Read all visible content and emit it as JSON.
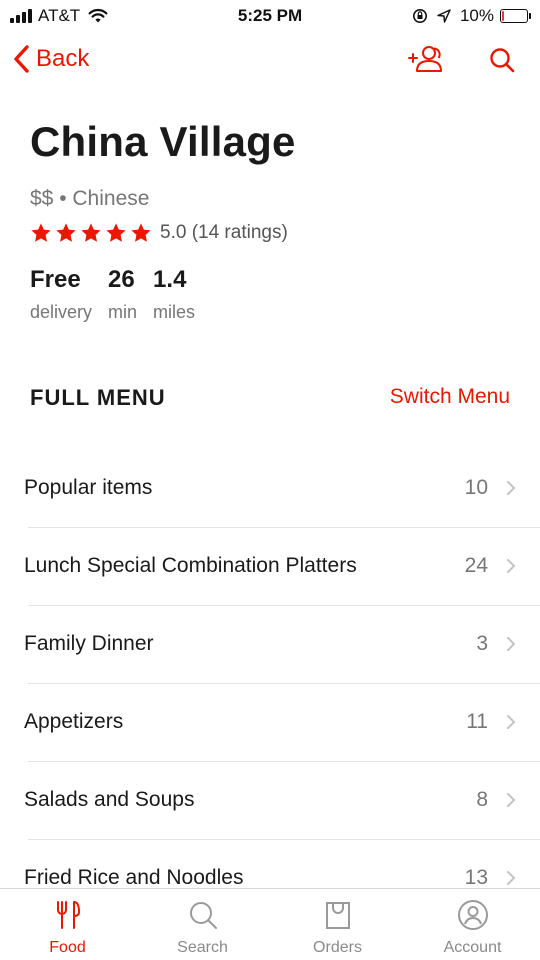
{
  "status_bar": {
    "carrier": "AT&T",
    "time": "5:25 PM",
    "battery": "10%",
    "battery_level": 0.1,
    "battery_color": "#e53935"
  },
  "nav": {
    "back_label": "Back",
    "icons": [
      "add-friend-icon",
      "search-icon"
    ],
    "accent_color": "#eb1700"
  },
  "store": {
    "name": "China Village",
    "meta": "$$ • Chinese",
    "rating_stars": 5,
    "rating_text": "5.0 (14 ratings)",
    "stats": [
      {
        "value": "Free",
        "label": "delivery"
      },
      {
        "value": "26",
        "label": "min"
      },
      {
        "value": "1.4",
        "label": "miles"
      }
    ]
  },
  "menu": {
    "header": "FULL MENU",
    "switch_label": "Switch Menu",
    "categories": [
      {
        "label": "Popular items",
        "count": "10"
      },
      {
        "label": "Lunch Special Combination Platters",
        "count": "24"
      },
      {
        "label": "Family Dinner",
        "count": "3"
      },
      {
        "label": "Appetizers",
        "count": "11"
      },
      {
        "label": "Salads and Soups",
        "count": "8"
      },
      {
        "label": "Fried Rice and Noodles",
        "count": "13"
      }
    ]
  },
  "tab_bar": {
    "tabs": [
      {
        "label": "Food",
        "icon": "fork-knife-icon",
        "active": true
      },
      {
        "label": "Search",
        "icon": "search-icon",
        "active": false
      },
      {
        "label": "Orders",
        "icon": "bag-icon",
        "active": false
      },
      {
        "label": "Account",
        "icon": "person-icon",
        "active": false
      }
    ]
  }
}
